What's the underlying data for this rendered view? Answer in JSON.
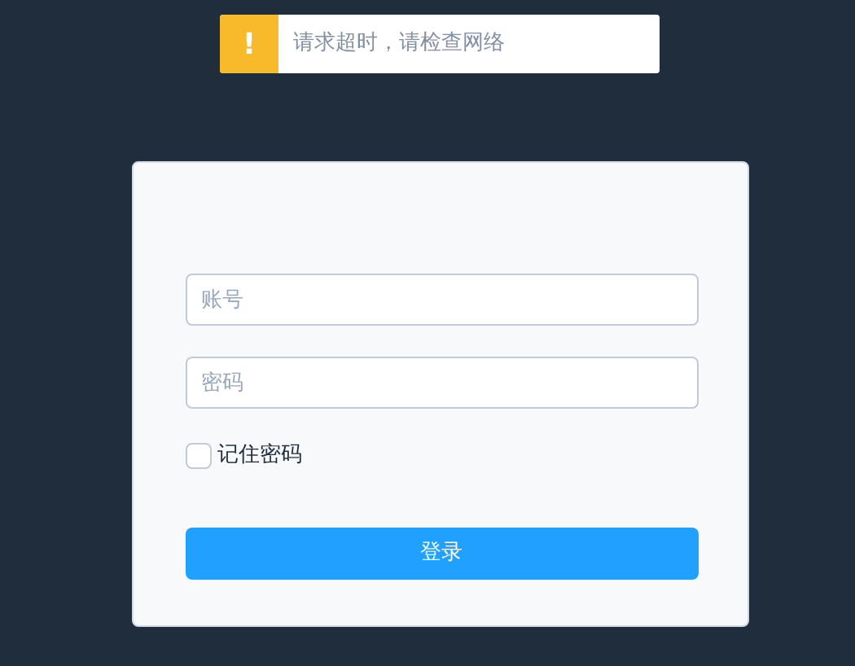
{
  "toast": {
    "kind": "warning",
    "icon": "!",
    "message": "请求超时，请检查网络"
  },
  "login_form": {
    "account": {
      "placeholder": "账号"
    },
    "password": {
      "placeholder": "密码"
    },
    "remember": {
      "label": "记住密码",
      "checked": false
    },
    "submit": "登录"
  }
}
